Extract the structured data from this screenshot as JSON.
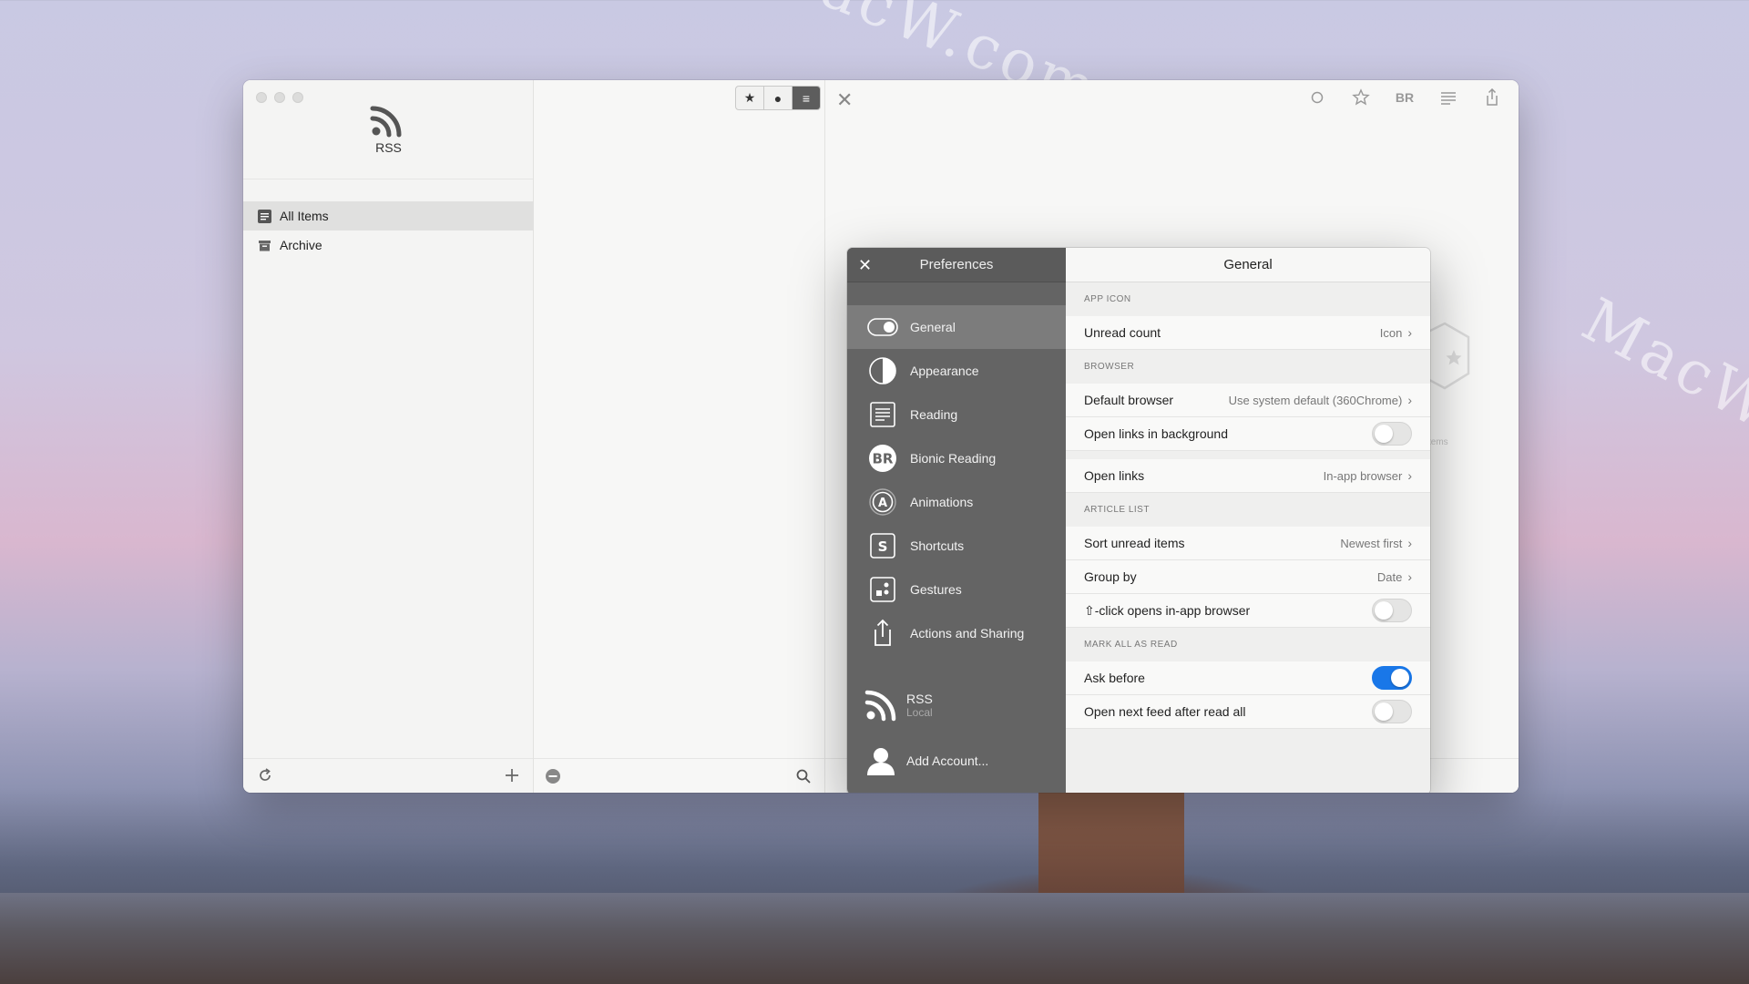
{
  "watermark": "MacW.com",
  "app": {
    "name": "RSS",
    "sidebar": {
      "items": [
        {
          "label": "All Items",
          "icon": "list-icon",
          "selected": true
        },
        {
          "label": "Archive",
          "icon": "archive-icon",
          "selected": false
        }
      ]
    },
    "list": {
      "filter_segments": [
        "★",
        "●",
        "≡"
      ],
      "selected_segment": 2
    },
    "reader": {
      "empty_text": "tems"
    }
  },
  "preferences": {
    "title": "Preferences",
    "close_icon": "close-icon",
    "nav": [
      {
        "label": "General",
        "icon": "toggle-icon",
        "selected": true
      },
      {
        "label": "Appearance",
        "icon": "contrast-icon"
      },
      {
        "label": "Reading",
        "icon": "text-lines-icon"
      },
      {
        "label": "Bionic Reading",
        "icon": "br-badge-icon"
      },
      {
        "label": "Animations",
        "icon": "animation-a-icon"
      },
      {
        "label": "Shortcuts",
        "icon": "shortcut-s-icon"
      },
      {
        "label": "Gestures",
        "icon": "gestures-icon"
      },
      {
        "label": "Actions and Sharing",
        "icon": "share-icon"
      }
    ],
    "accounts": [
      {
        "name": "RSS",
        "sub": "Local",
        "icon": "rss-icon"
      },
      {
        "name": "Add Account...",
        "sub": "",
        "icon": "person-icon"
      }
    ],
    "panel": {
      "title": "General",
      "sections": [
        {
          "header": "APP ICON",
          "rows": [
            {
              "label": "Unread count",
              "value": "Icon",
              "type": "disclosure"
            }
          ]
        },
        {
          "header": "BROWSER",
          "rows": [
            {
              "label": "Default browser",
              "value": "Use system default (360Chrome)",
              "type": "disclosure"
            },
            {
              "label": "Open links in background",
              "type": "toggle",
              "on": false
            },
            {
              "label": "Open links",
              "value": "In-app browser",
              "type": "disclosure"
            }
          ]
        },
        {
          "header": "ARTICLE LIST",
          "rows": [
            {
              "label": "Sort unread items",
              "value": "Newest first",
              "type": "disclosure"
            },
            {
              "label": "Group by",
              "value": "Date",
              "type": "disclosure"
            },
            {
              "label": "⇧-click opens in-app browser",
              "type": "toggle",
              "on": false
            }
          ]
        },
        {
          "header": "MARK ALL AS READ",
          "rows": [
            {
              "label": "Ask before",
              "type": "toggle",
              "on": true
            },
            {
              "label": "Open next feed after read all",
              "type": "toggle",
              "on": false
            }
          ]
        }
      ]
    }
  },
  "colors": {
    "accent": "#1977e8",
    "prefs_sidebar": "#646464"
  }
}
